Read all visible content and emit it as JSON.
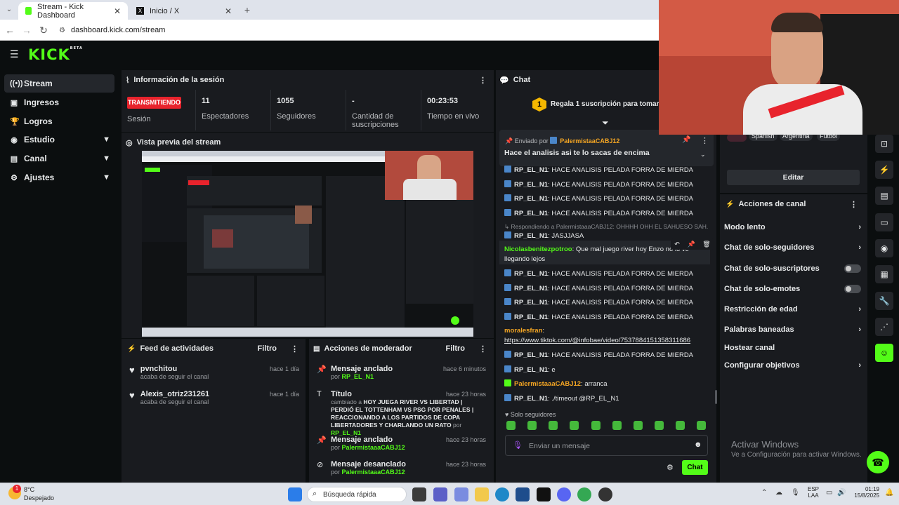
{
  "browser": {
    "tabs": [
      {
        "title": "Stream - Kick Dashboard"
      },
      {
        "title": "Inicio / X"
      }
    ],
    "url": "dashboard.kick.com/stream"
  },
  "kick": {
    "logo": "KICK",
    "logo_sup": "BETA"
  },
  "sidebar": {
    "items": [
      {
        "label": "Stream",
        "icon": "stream-icon"
      },
      {
        "label": "Ingresos",
        "icon": "income-icon"
      },
      {
        "label": "Logros",
        "icon": "trophy-icon"
      },
      {
        "label": "Estudio",
        "icon": "studio-icon"
      },
      {
        "label": "Canal",
        "icon": "channel-icon"
      },
      {
        "label": "Ajustes",
        "icon": "gear-icon"
      }
    ]
  },
  "session": {
    "title": "Información de la sesión",
    "live_badge": "TRANSMITIENDO",
    "live_label": "Sesión",
    "stats": [
      {
        "value": "11",
        "label": "Espectadores"
      },
      {
        "value": "1055",
        "label": "Seguidores"
      },
      {
        "value": "-",
        "label": "Cantidad de suscripciones"
      },
      {
        "value": "00:23:53",
        "label": "Tiempo en vivo"
      }
    ]
  },
  "preview": {
    "title": "Vista previa del stream"
  },
  "feed": {
    "title": "Feed de actividades",
    "filter": "Filtro",
    "items": [
      {
        "name": "pvnchitou",
        "sub": "acaba de seguir el canal",
        "time": "hace 1 día"
      },
      {
        "name": "Alexis_otriz231261",
        "sub": "acaba de seguir el canal",
        "time": "hace 1 día"
      }
    ]
  },
  "modactions": {
    "title": "Acciones de moderador",
    "filter": "Filtro",
    "items": [
      {
        "title": "Mensaje anclado",
        "time": "hace 6 minutos",
        "by_prefix": "por",
        "by": "RP_EL_N1"
      },
      {
        "title": "Título",
        "time": "hace 23 horas",
        "prefix": "cambiado a",
        "text": "HOY JUEGA RIVER VS LIBERTAD | PERDIÓ EL TOTTENHAM VS PSG POR PENALES | REACCIONANDO A LOS PARTIDOS DE COPA LIBERTADORES Y CHARLANDO UN RATO",
        "by_prefix": "por",
        "by": "RP_EL_N1"
      },
      {
        "title": "Mensaje anclado",
        "time": "hace 23 horas",
        "by_prefix": "por",
        "by": "PalermistaaaCABJ12"
      },
      {
        "title": "Mensaje desanclado",
        "time": "hace 23 horas",
        "by_prefix": "por",
        "by": "PalermistaaaCABJ12"
      }
    ]
  },
  "chat": {
    "title": "Chat",
    "gift_num": "1",
    "gift_text": "Regala 1 suscripción para tomar la po",
    "pinned_by_label": "Enviado por",
    "pinned_by": "PalermistaaCABJ12",
    "pinned_text": "Hace el analisis asi te lo sacas de encima",
    "reply_to": "Respondiendo a PalermistaaaCABJ12: OHHHH OHH EL SAHUESO SAH...",
    "messages": [
      {
        "user": "RP_EL_N1",
        "text": ": HACE ANALISIS PELADA FORRA DE MIERDA"
      },
      {
        "user": "RP_EL_N1",
        "text": ": HACE ANALISIS PELADA FORRA DE MIERDA"
      },
      {
        "user": "RP_EL_N1",
        "text": ": HACE ANALISIS PELADA FORRA DE MIERDA"
      },
      {
        "user": "RP_EL_N1",
        "text": ": HACE ANALISIS PELADA FORRA DE MIERDA"
      },
      {
        "user": "RP_EL_N1",
        "text": ": JASJJASA"
      },
      {
        "user": "Nicolasbenitezpotroo",
        "text": ": Que mal juego river hoy Enzo no lo ve",
        "text2": "llegando lejos"
      },
      {
        "user": "RP_EL_N1",
        "text": ": HACE ANALISIS PELADA FORRA DE MIERDA"
      },
      {
        "user": "RP_EL_N1",
        "text": ": HACE ANALISIS PELADA FORRA DE MIERDA"
      },
      {
        "user": "RP_EL_N1",
        "text": ": HACE ANALISIS PELADA FORRA DE MIERDA"
      },
      {
        "user": "RP_EL_N1",
        "text": ": HACE ANALISIS PELADA FORRA DE MIERDA"
      },
      {
        "user": "moralesfran",
        "text": ":",
        "link": "https://www.tiktok.com/@infobae/video/7537884151358311686"
      },
      {
        "user": "RP_EL_N1",
        "text": ": HACE ANALISIS PELADA FORRA DE MIERDA"
      },
      {
        "user": "RP_EL_N1",
        "text": ": e"
      },
      {
        "user": "PalermistaaaCABJ12",
        "text": ": arranca"
      },
      {
        "user": "RP_EL_N1",
        "text": ": ./timeout @RP_EL_N1"
      }
    ],
    "mode_label": "Solo seguidores",
    "input_placeholder": "Enviar un mensaje",
    "send_label": "Chat"
  },
  "channel": {
    "tags": [
      "Spanish",
      "Argentina",
      "Fútbol"
    ],
    "edit_label": "Editar",
    "actions_title": "Acciones de canal",
    "actions": [
      {
        "label": "Modo lento",
        "kind": "chevron"
      },
      {
        "label": "Chat de solo-seguidores",
        "kind": "chevron"
      },
      {
        "label": "Chat de solo-suscriptores",
        "kind": "toggle"
      },
      {
        "label": "Chat de solo-emotes",
        "kind": "toggle"
      },
      {
        "label": "Restricción de edad",
        "kind": "chevron"
      },
      {
        "label": "Palabras baneadas",
        "kind": "chevron"
      },
      {
        "label": "Hostear canal",
        "kind": "none"
      },
      {
        "label": "Configurar objetivos",
        "kind": "chevron"
      }
    ]
  },
  "windows_activation": {
    "title": "Activar Windows",
    "sub": "Ve a Configuración para activar Windows."
  },
  "taskbar": {
    "weather_temp": "8°C",
    "weather_desc": "Despejado",
    "notif_count": "1",
    "search_placeholder": "Búsqueda rápida",
    "lang1": "ESP",
    "lang2": "LAA",
    "time": "01:19",
    "date": "15/8/2025"
  },
  "colors": {
    "accent": "#53fc18",
    "panel": "#191b1f",
    "live": "#e8232c"
  }
}
